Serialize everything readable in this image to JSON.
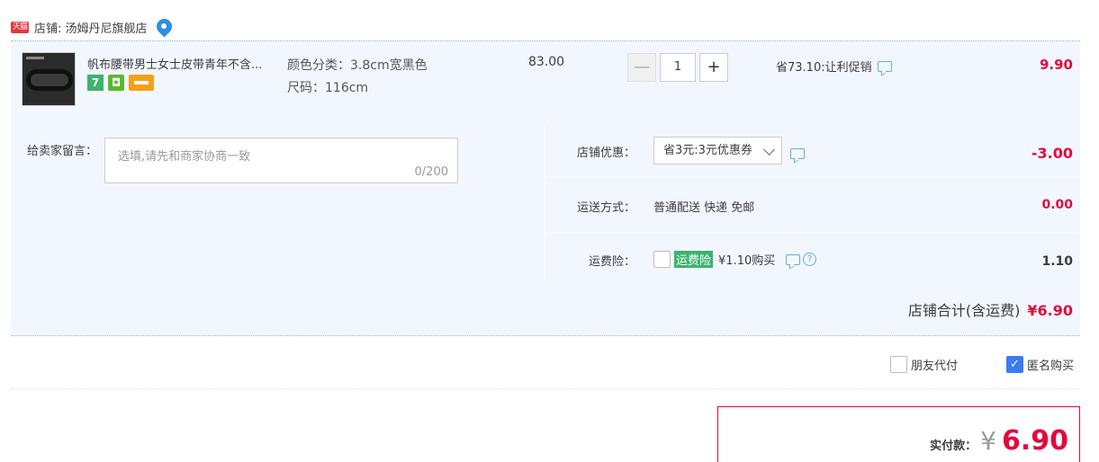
{
  "shop": {
    "logo_text": "天猫",
    "name": "店铺: 汤姆丹尼旗舰店"
  },
  "item": {
    "title": "帆布腰带男士女士皮带青年不含...",
    "badges": [
      "7",
      "shield",
      "card"
    ],
    "sku_color": "颜色分类：3.8cm宽黑色",
    "sku_size": "尺码：116cm",
    "unit_price": "83.00",
    "qty_minus": "—",
    "quantity": "1",
    "qty_plus": "+",
    "promo": "省73.10:让利促销",
    "total": "9.90"
  },
  "message": {
    "label": "给卖家留言：",
    "placeholder": "选填,请先和商家协商一致",
    "count": "0/200"
  },
  "shop_coupon": {
    "label": "店铺优惠：",
    "selected": "省3元:3元优惠券",
    "amount": "-3.00"
  },
  "shipping": {
    "label": "运送方式：",
    "value": "普通配送 快递 免邮",
    "amount": "0.00"
  },
  "insurance": {
    "label": "运费险：",
    "tag": "运费险",
    "value": "¥1.10购买",
    "amount": "1.10"
  },
  "shop_total": {
    "label": "店铺合计(含运费)",
    "amount": "¥6.90"
  },
  "friend_pay": {
    "label": "朋友代付",
    "checked": false
  },
  "anonymous": {
    "label": "匿名购买",
    "checked": true
  },
  "payment": {
    "label": "实付款：",
    "currency": "¥",
    "amount": "6.90"
  },
  "colors": {
    "accent": "#e4093c",
    "highlight_bg": "#f2f7ff",
    "tmall_red": "#e4393c",
    "green": "#3db36e",
    "link_blue": "#66a8e2"
  }
}
